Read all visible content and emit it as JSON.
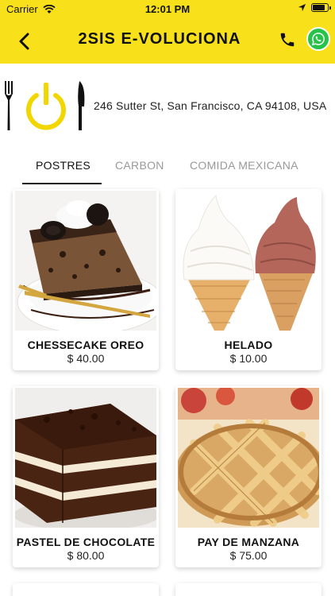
{
  "status_bar": {
    "carrier": "Carrier",
    "time": "12:01 PM",
    "battery_level": 0.9
  },
  "header": {
    "title": "2SIS E-VOLUCIONA",
    "background_color": "#f8e11b",
    "whatsapp_color": "#27c24a"
  },
  "restaurant": {
    "address": "246 Sutter St, San Francisco, CA 94108, USA",
    "logo_icon": "fork-power-knife-logo"
  },
  "tabs": [
    {
      "label": "POSTRES",
      "active": true
    },
    {
      "label": "CARBON",
      "active": false
    },
    {
      "label": "COMIDA MEXICANA",
      "active": false
    }
  ],
  "products": [
    {
      "name": "CHESSECAKE OREO",
      "price": "$ 40.00",
      "image": "oreo-cheesecake-image"
    },
    {
      "name": "HELADO",
      "price": "$ 10.00",
      "image": "ice-cream-cones-image"
    },
    {
      "name": "PASTEL DE CHOCOLATE",
      "price": "$ 80.00",
      "image": "chocolate-cake-image"
    },
    {
      "name": "PAY DE MANZANA",
      "price": "$ 75.00",
      "image": "apple-pie-image"
    }
  ]
}
